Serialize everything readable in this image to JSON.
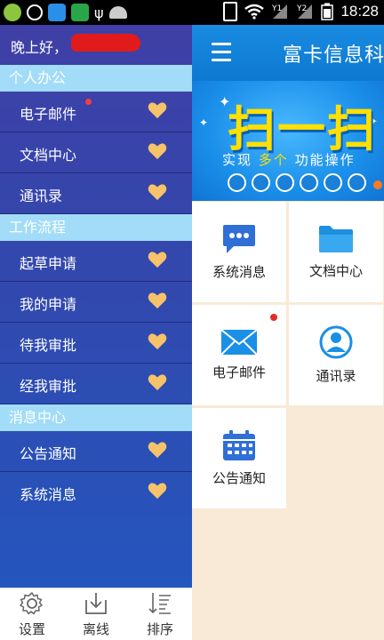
{
  "status_bar": {
    "time": "18:28",
    "icons": [
      "app-icon",
      "location-icon",
      "weather-icon",
      "shield-icon",
      "usb-icon",
      "android-icon",
      "vibrate-icon",
      "wifi-icon",
      "signal-1-icon",
      "signal-2-icon",
      "battery-icon"
    ]
  },
  "app_bar": {
    "title": "富卡信息科"
  },
  "banner": {
    "title": "扫一扫",
    "subtitle_prefix": "实现",
    "subtitle_highlight": "多个",
    "subtitle_suffix": "功能操作"
  },
  "tiles": [
    {
      "label": "系统消息",
      "icon": "message-icon",
      "color": "#2f6fd6"
    },
    {
      "label": "文档中心",
      "icon": "folder-icon",
      "color": "#1f8fe0"
    },
    {
      "label": "电子邮件",
      "icon": "mail-icon",
      "color": "#1a8fe6",
      "badge": true
    },
    {
      "label": "通讯录",
      "icon": "contact-icon",
      "color": "#1a8fe6"
    },
    {
      "label": "公告通知",
      "icon": "calendar-icon",
      "color": "#2f6fd6"
    }
  ],
  "drawer": {
    "greeting": "晚上好，",
    "sections": [
      {
        "title": "个人办公",
        "items": [
          {
            "label": "电子邮件",
            "badge": true
          },
          {
            "label": "文档中心"
          },
          {
            "label": "通讯录"
          }
        ]
      },
      {
        "title": "工作流程",
        "items": [
          {
            "label": "起草申请"
          },
          {
            "label": "我的申请"
          },
          {
            "label": "待我审批"
          },
          {
            "label": "经我审批"
          }
        ]
      },
      {
        "title": "消息中心",
        "items": [
          {
            "label": "公告通知"
          },
          {
            "label": "系统消息"
          }
        ]
      }
    ],
    "bottom_tabs": [
      {
        "label": "设置",
        "icon": "gear-icon"
      },
      {
        "label": "离线",
        "icon": "download-icon"
      },
      {
        "label": "排序",
        "icon": "sort-icon"
      }
    ]
  },
  "colors": {
    "drawer_top": "#3f3fa6",
    "drawer_bottom": "#2258c0",
    "section_bg": "#a2dcf8",
    "heart": "#f6c26a",
    "app_bar": "#1a8be2",
    "content_bg": "#f8ead6",
    "badge": "#e62a2a"
  }
}
